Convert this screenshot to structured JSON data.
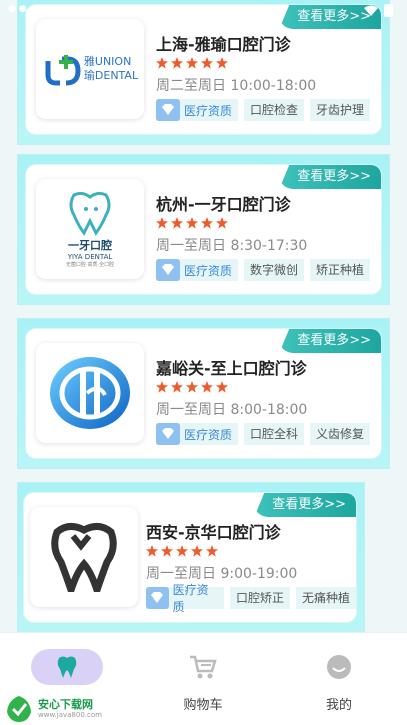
{
  "clinics": [
    {
      "title": "上海-雅瑜口腔门诊",
      "hours": "周二至周日 10:00-18:00",
      "more_label": "查看更多>>",
      "badge": "医疗资质",
      "tags": [
        "口腔检查",
        "牙齿护理"
      ],
      "logo": {
        "icon": "union-dental-logo",
        "text_top": "雅UNION",
        "text_bottom": "瑜DENTAL"
      }
    },
    {
      "title": "杭州-一牙口腔门诊",
      "hours": "周一至周日 8:30-17:30",
      "more_label": "查看更多>>",
      "badge": "医疗资质",
      "tags": [
        "数字微创",
        "矫正种植"
      ],
      "logo": {
        "icon": "yiya-dental-logo",
        "text_top": "一牙口腔",
        "text_bottom": "YIYA DENTAL",
        "text_sub": "无菌口腔·高质·全口腔"
      }
    },
    {
      "title": "嘉峪关-至上口腔门诊",
      "hours": "周一至周日 8:00-18:00",
      "more_label": "查看更多>>",
      "badge": "医疗资质",
      "tags": [
        "口腔全科",
        "义齿修复"
      ],
      "logo": {
        "icon": "zhishang-dental-logo"
      }
    },
    {
      "title": "西安-京华口腔门诊",
      "hours": "周一至周日 9:00-19:00",
      "more_label": "查看更多>>",
      "badge": "医疗资质",
      "tags": [
        "口腔矫正",
        "无痛种植"
      ],
      "logo": {
        "icon": "tooth-outline-logo"
      }
    }
  ],
  "tabbar": {
    "tabs": [
      {
        "label": "",
        "icon": "tooth-icon",
        "active": true
      },
      {
        "label": "购物车",
        "icon": "cart-icon",
        "active": false
      },
      {
        "label": "我的",
        "icon": "profile-icon",
        "active": false
      }
    ]
  },
  "watermark": {
    "title": "安心下载网",
    "url": "www.java800.com"
  },
  "colors": {
    "accent_teal": "#1da69f",
    "card_bg": "#a8f2f5",
    "star": "#ef5a2a",
    "badge_text": "#3a8ad8",
    "tab_pill": "#d9d2f6"
  }
}
